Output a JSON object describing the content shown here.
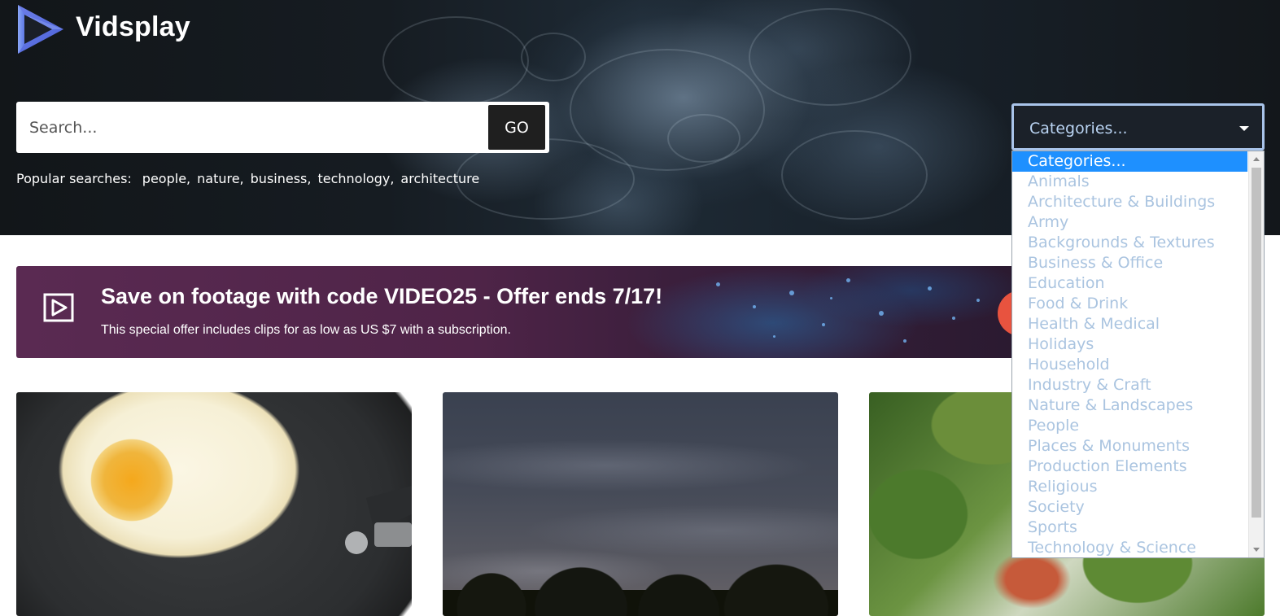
{
  "brand": {
    "name": "Vidsplay"
  },
  "search": {
    "placeholder": "Search...",
    "go_label": "GO"
  },
  "popular": {
    "label": "Popular searches:",
    "tags": [
      "people,",
      "nature,",
      "business,",
      "technology,",
      "architecture"
    ]
  },
  "categories": {
    "selected": "Categories...",
    "options": [
      "Categories...",
      "Animals",
      "Architecture & Buildings",
      "Army",
      "Backgrounds & Textures",
      "Business & Office",
      "Education",
      "Food & Drink",
      "Health & Medical",
      "Holidays",
      "Household",
      "Industry & Craft",
      "Nature & Landscapes",
      "People",
      "Places & Monuments",
      "Production Elements",
      "Religious",
      "Society",
      "Sports",
      "Technology & Science"
    ]
  },
  "promo": {
    "title": "Save on footage with code VIDEO25 - Offer ends 7/17!",
    "subtitle": "This special offer includes clips for as low as US $7 with a subscription.",
    "icon": "video-play-icon"
  },
  "thumbnails": [
    {
      "subject": "fried egg in pan"
    },
    {
      "subject": "night sky with clouds over trees"
    },
    {
      "subject": "forest canopy"
    }
  ],
  "colors": {
    "selected_option_bg": "#1e90ff",
    "option_text": "#aac4e0",
    "select_border": "#a9c4ea",
    "go_button_bg": "#1f1f1f",
    "promo_cta": "#e8533f"
  }
}
